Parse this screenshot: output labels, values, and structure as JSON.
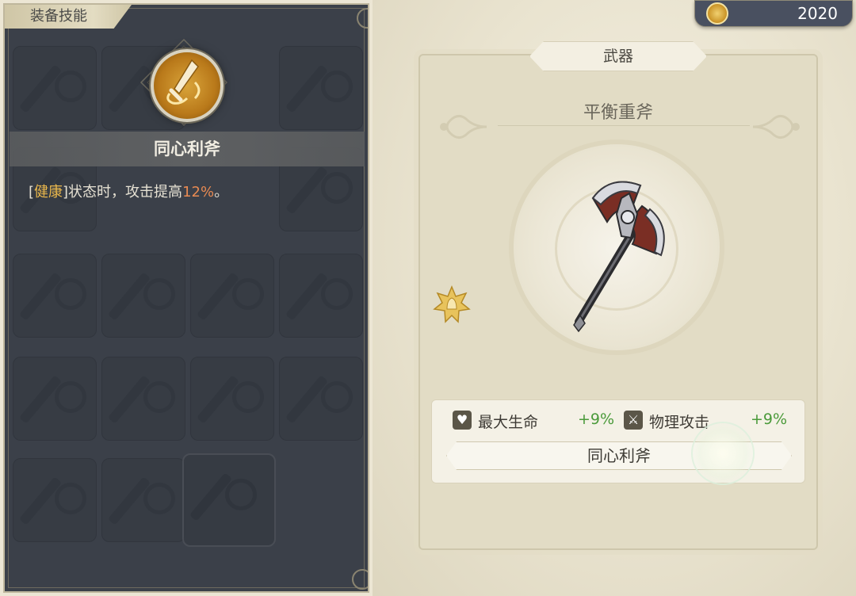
{
  "equip_skill_panel": {
    "tab_label": "装备技能",
    "featured_skill": {
      "name": "同心利斧",
      "icon": "sword-emblem-icon",
      "description": {
        "prefix": "[",
        "keyword": "健康",
        "middle": "]状态时，攻击提高",
        "value": "12%",
        "suffix": "。"
      }
    },
    "slots": [
      {
        "icon": "sword-silhouette-icon"
      },
      {
        "icon": "sword-silhouette-icon"
      },
      {
        "icon": "sword-silhouette-icon"
      },
      {
        "icon": "sword-silhouette-icon"
      },
      {
        "icon": "sword-silhouette-icon"
      },
      {
        "icon": "sword-silhouette-icon"
      },
      {
        "icon": "sword-silhouette-icon"
      },
      {
        "icon": "sword-silhouette-icon"
      },
      {
        "icon": "sword-silhouette-icon"
      },
      {
        "icon": "sword-silhouette-icon"
      },
      {
        "icon": "sword-silhouette-icon"
      },
      {
        "icon": "sword-silhouette-icon"
      },
      {
        "icon": "sword-silhouette-icon"
      },
      {
        "icon": "sword-silhouette-icon"
      },
      {
        "icon": "sword-silhouette-icon"
      },
      {
        "icon": "sword-silhouette-icon"
      },
      {
        "icon": "sword-silhouette-icon"
      },
      {
        "icon": "sword-silhouette-icon"
      },
      {
        "icon": "sword-silhouette-icon"
      }
    ]
  },
  "currency": {
    "icon": "gold-coin-icon",
    "amount": "2020"
  },
  "weapon": {
    "category": "武器",
    "name": "平衡重斧",
    "image": "battle-axe-icon",
    "badge_icon": "gold-star-badge-icon",
    "stats": [
      {
        "icon": "heart-icon",
        "label": "最大生命",
        "value": "+9%"
      },
      {
        "icon": "sword-icon",
        "label": "物理攻击",
        "value": "+9%"
      }
    ],
    "skill_name": "同心利斧"
  },
  "colors": {
    "panel_dark": "#3b4049",
    "keyword_gold": "#e9b74c",
    "value_orange": "#e88a52",
    "stat_green": "#4a9a3a",
    "card_bg": "#e2dcc5"
  }
}
